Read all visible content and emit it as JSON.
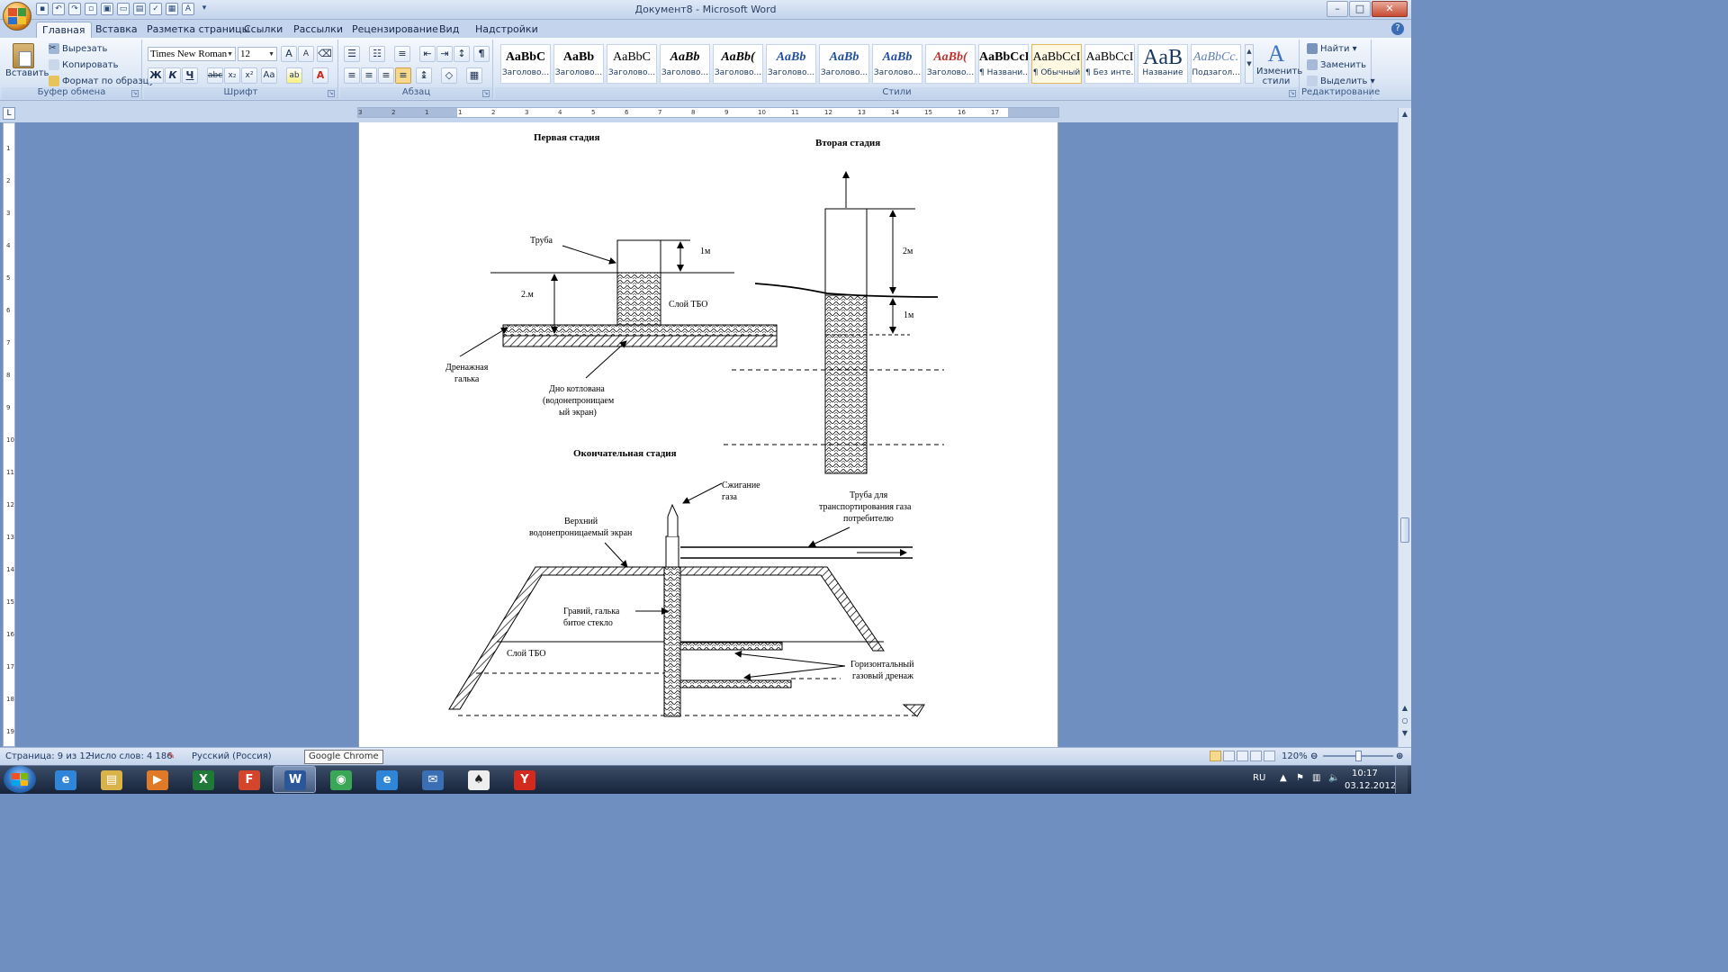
{
  "window": {
    "title": "Документ8 - Microsoft Word",
    "minimize": "–",
    "maximize": "□",
    "close": "✕"
  },
  "tabs": [
    "Главная",
    "Вставка",
    "Разметка страницы",
    "Ссылки",
    "Рассылки",
    "Рецензирование",
    "Вид",
    "Надстройки"
  ],
  "ribbon": {
    "clipboard": {
      "paste": "Вставить",
      "cut": "Вырезать",
      "copy": "Копировать",
      "format_painter": "Формат по образцу",
      "label": "Буфер обмена"
    },
    "font": {
      "name": "Times New Roman",
      "size": "12",
      "grow": "A",
      "shrink": "A",
      "clear": "⌫",
      "bold": "Ж",
      "italic": "К",
      "underline": "Ч",
      "strike": "abc",
      "sub": "x₂",
      "sup": "x²",
      "case": "Aa",
      "highlight": "ab",
      "color": "A",
      "label": "Шрифт"
    },
    "paragraph": {
      "label": "Абзац"
    },
    "styles": {
      "items": [
        {
          "sample": "AaBbC",
          "name": "Заголово..."
        },
        {
          "sample": "AaBb",
          "name": "Заголово..."
        },
        {
          "sample": "AaBbC",
          "name": "Заголово..."
        },
        {
          "sample": "AaBb",
          "name": "Заголово..."
        },
        {
          "sample": "AaBb(",
          "name": "Заголово..."
        },
        {
          "sample": "AaBb",
          "name": "Заголово..."
        },
        {
          "sample": "AaBb",
          "name": "Заголово..."
        },
        {
          "sample": "AaBb",
          "name": "Заголово..."
        },
        {
          "sample": "AaBb(",
          "name": "Заголово..."
        },
        {
          "sample": "AaBbCcI",
          "name": "¶ Названи..."
        },
        {
          "sample": "AaBbCcI",
          "name": "¶ Обычный"
        },
        {
          "sample": "AaBbCcI",
          "name": "¶ Без инте..."
        },
        {
          "sample": "AaB",
          "name": "Название"
        },
        {
          "sample": "AaBbCc.",
          "name": "Подзагол..."
        }
      ],
      "change": "Изменить стили",
      "label": "Стили"
    },
    "editing": {
      "find": "Найти",
      "replace": "Заменить",
      "select": "Выделить",
      "label": "Редактирование"
    }
  },
  "ruler_ticks": [
    "3",
    "2",
    "1",
    "1",
    "2",
    "3",
    "4",
    "5",
    "6",
    "7",
    "8",
    "9",
    "10",
    "11",
    "12",
    "13",
    "14",
    "15",
    "16",
    "17"
  ],
  "vruler_ticks": [
    "1",
    "2",
    "3",
    "4",
    "5",
    "6",
    "7",
    "8",
    "9",
    "10",
    "11",
    "12",
    "13",
    "14",
    "15",
    "16",
    "17",
    "18",
    "19"
  ],
  "document": {
    "stage1": {
      "title": "Первая стадия",
      "pipe": "Труба",
      "dim_top": "1м",
      "dim_depth": "2.м",
      "layer": "Слой ТБО",
      "drain1": "Дренажная",
      "drain2": "галька",
      "bottom1": "Дно котлована",
      "bottom2": "(водонепроницаем",
      "bottom3": "ый экран)"
    },
    "stage2": {
      "title": "Вторая стадия",
      "dim_top": "2м",
      "dim_bottom": "1м"
    },
    "stage3": {
      "title": "Окончательная стадия",
      "burn1": "Сжигание",
      "burn2": "газа",
      "cover1": "Верхний",
      "cover2": "водонепроницаемый экран",
      "pipe1": "Труба для",
      "pipe2": "транспортирования газа",
      "pipe3": "потребителю",
      "gravel1": "Гравий, галька",
      "gravel2": "битое стекло",
      "layer": "Слой ТБО",
      "drain1": "Горизонтальный",
      "drain2": "газовый дренаж"
    }
  },
  "status": {
    "page": "Страница: 9 из 12",
    "words": "Число слов: 4 186",
    "language": "Русский (Россия)",
    "zoom": "120%",
    "tooltip": "Google Chrome"
  },
  "tray": {
    "lang": "RU",
    "time": "10:17",
    "date": "03.12.2012"
  },
  "taskbar_apps": [
    {
      "name": "Internet Explorer",
      "glyph": "e",
      "color": "#2f86d8"
    },
    {
      "name": "Проводник",
      "glyph": "▤",
      "color": "#d9b24a"
    },
    {
      "name": "Media Player",
      "glyph": "▶",
      "color": "#e07a26"
    },
    {
      "name": "Excel",
      "glyph": "X",
      "color": "#1f7a3a"
    },
    {
      "name": "Foxit Reader",
      "glyph": "F",
      "color": "#d5452c"
    },
    {
      "name": "Word",
      "glyph": "W",
      "color": "#2b579a"
    },
    {
      "name": "Google Chrome",
      "glyph": "◉",
      "color": "#3aa757"
    },
    {
      "name": "Internet Explorer",
      "glyph": "e",
      "color": "#2f86d8"
    },
    {
      "name": "Почта",
      "glyph": "✉",
      "color": "#3a6fb5"
    },
    {
      "name": "Пасьянс",
      "glyph": "♠",
      "color": "#eeeeee"
    },
    {
      "name": "Яндекс",
      "glyph": "Y",
      "color": "#d42a1e"
    }
  ]
}
